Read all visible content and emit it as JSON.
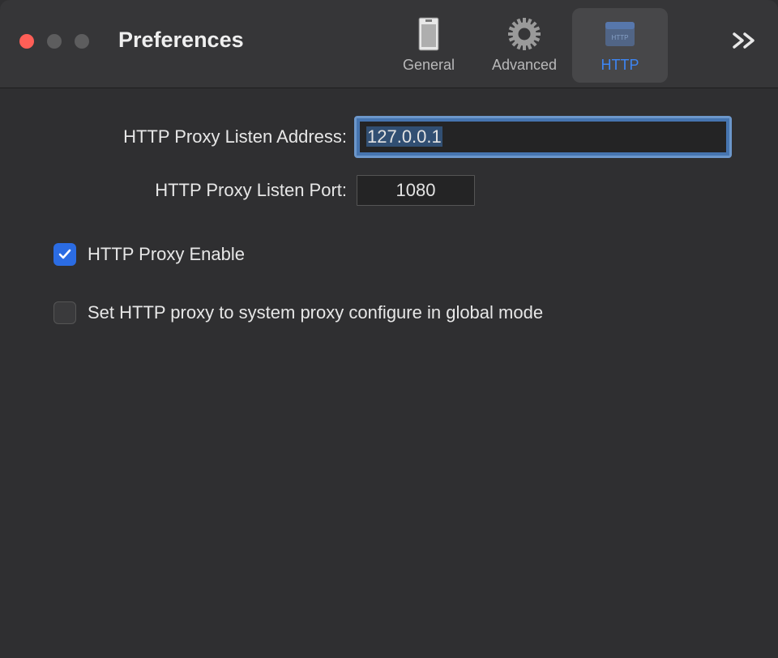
{
  "window": {
    "title": "Preferences"
  },
  "tabs": {
    "general": "General",
    "advanced": "Advanced",
    "http": "HTTP"
  },
  "form": {
    "addressLabel": "HTTP Proxy Listen Address:",
    "addressValue": "127.0.0.1",
    "portLabel": "HTTP Proxy Listen Port:",
    "portValue": "1080"
  },
  "checkboxes": {
    "enableLabel": "HTTP Proxy Enable",
    "systemProxyLabel": "Set HTTP proxy to system proxy configure in global mode"
  }
}
